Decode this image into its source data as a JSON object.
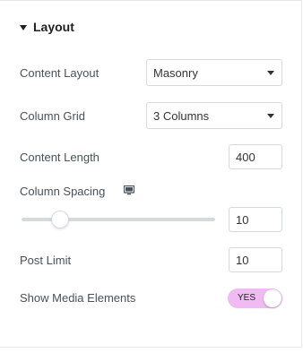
{
  "section": {
    "title": "Layout",
    "collapse_icon": "caret-down-icon"
  },
  "content_layout": {
    "label": "Content Layout",
    "value": "Masonry"
  },
  "column_grid": {
    "label": "Column Grid",
    "value": "3 Columns"
  },
  "content_length": {
    "label": "Content Length",
    "value": "400"
  },
  "column_spacing": {
    "label": "Column Spacing",
    "device_icon": "desktop-monitor-icon",
    "value": "10",
    "slider_fraction": 0.2
  },
  "post_limit": {
    "label": "Post Limit",
    "value": "10"
  },
  "show_media": {
    "label": "Show Media Elements",
    "toggle_text": "YES",
    "on": true
  },
  "colors": {
    "toggle_on": "#f0baf3",
    "border": "#d5dadf",
    "label": "#495157"
  }
}
